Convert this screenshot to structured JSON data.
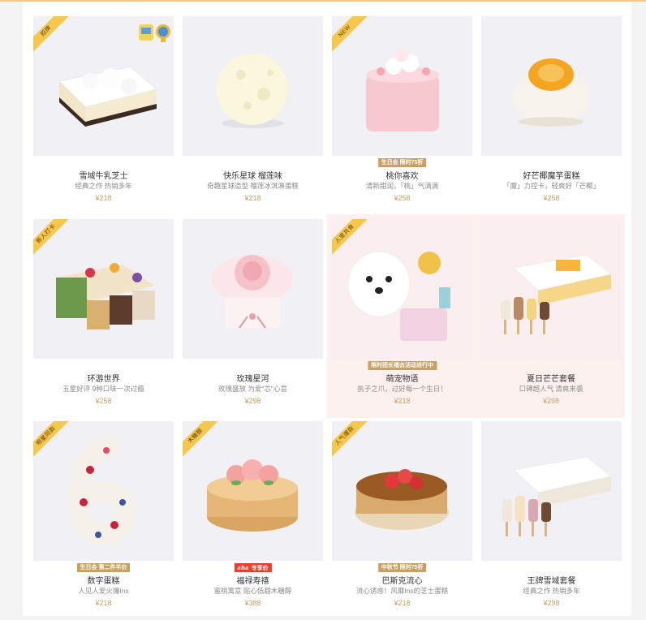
{
  "products": [
    {
      "name": "雪域牛乳芝士",
      "desc": "经典之作 热销多年",
      "price": "¥218",
      "tag": "招牌",
      "promo": "",
      "badges": true
    },
    {
      "name": "快乐星球 榴莲味",
      "desc": "奇趣星球造型 榴莲冰淇淋蛋糕",
      "price": "¥218",
      "tag": "",
      "promo": ""
    },
    {
      "name": "桃你喜欢",
      "desc": "清新甜润，「桃」气满满",
      "price": "¥258",
      "tag": "NEW",
      "promo": "生日会 限时75折"
    },
    {
      "name": "好芒椰魔芋蛋糕",
      "desc": "「魔」力控卡，轻爽好「芒椰」",
      "price": "¥258",
      "tag": "",
      "promo": ""
    },
    {
      "name": "环游世界",
      "desc": "五星好评 9种口味一次过瘾",
      "price": "¥258",
      "tag": "新人打卡",
      "promo": ""
    },
    {
      "name": "玫瑰星河",
      "desc": "玫瑰盛放 为爱\"芯\"心意",
      "price": "¥298",
      "tag": "",
      "promo": ""
    },
    {
      "name": "萌宠物语",
      "desc": "执子之爪，过好每一个生日！",
      "price": "¥218",
      "tag": "人宠共食",
      "promo": "限时团长福去活动进行中"
    },
    {
      "name": "夏日芒芒套餐",
      "desc": "口碑超人气 清爽来袭",
      "price": "¥298",
      "tag": "",
      "promo": ""
    },
    {
      "name": "数字蛋糕",
      "desc": "人见人爱火爆Ins",
      "price": "¥218",
      "tag": "明星同款",
      "promo": "生日会 第二件半价"
    },
    {
      "name": "福禄寿禧",
      "desc": "蜜桃寓意 贴心低甜木糖醇",
      "price": "¥388",
      "tag": "木糖醇",
      "promo": "专享价",
      "promo_prefix": "aha",
      "promo_style": "red"
    },
    {
      "name": "巴斯克流心",
      "desc": "流心诱惑！风靡Ins的芝士蛋糕",
      "price": "¥218",
      "tag": "人气爆款",
      "promo": "中秋节 限时75折"
    },
    {
      "name": "王牌雪域套餐",
      "desc": "经典之作 热销多年",
      "price": "¥298",
      "tag": "",
      "promo": ""
    }
  ],
  "colors": {
    "accent": "#c9a062",
    "tag_bg": "#f5c74d",
    "promo_red": "#e8402d",
    "highlight_bg": "#fdf1f0"
  }
}
